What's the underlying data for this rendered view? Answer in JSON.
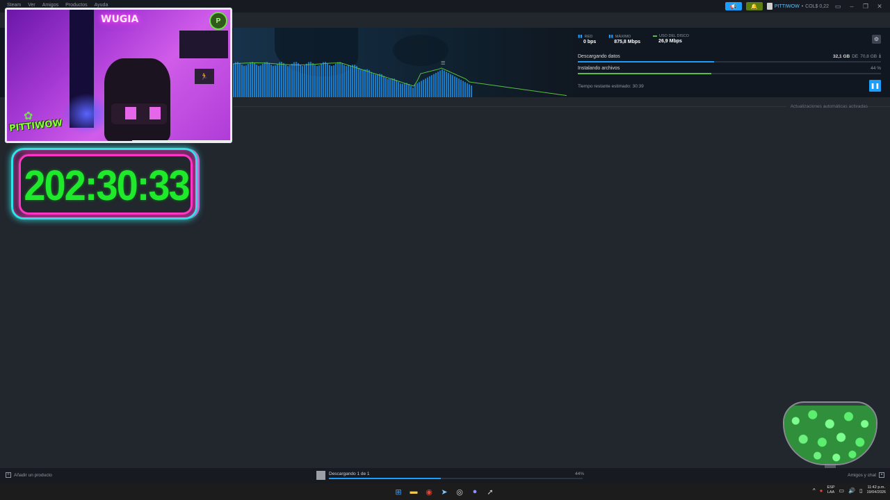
{
  "window": {
    "menu": [
      "Steam",
      "Ver",
      "Amigos",
      "Productos",
      "Ayuda"
    ],
    "account_name": "PITTIWOW",
    "wallet": "COL$ 0,22"
  },
  "stats": {
    "network_label": "RED",
    "network_value": "0 bps",
    "peak_label": "MÁXIMO",
    "peak_value": "875,8 Mbps",
    "disk_label": "USO DEL DISCO",
    "disk_value": "26,9 Mbps"
  },
  "download": {
    "label": "Descargando datos",
    "downloaded": "32,1 GB",
    "of_word": "DE",
    "total": "70,8 GB",
    "progress": 0.45
  },
  "install": {
    "label": "Instalando archivos",
    "percent": "44 %",
    "progress": 0.44
  },
  "eta": "Tiempo restante estimado: 30:39",
  "auto_updates": "Actualizaciones automáticas activadas",
  "overlay": {
    "neon": "WUGIA",
    "logo_text": "PITTIWOW",
    "timer": "202:30:33"
  },
  "footer": {
    "add_product": "Añadir un producto",
    "downloading": "Descargando 1 de 1",
    "percent": "44%",
    "progress": 0.44,
    "friends": "Amigos y chat"
  },
  "taskbar": {
    "lang1": "ESP",
    "lang2": "LAA",
    "time": "11:42 p.m.",
    "date": "19/04/2026"
  },
  "colors": {
    "accent": "#1a9fff",
    "green": "#59bf40",
    "timer_green": "#1eea2b",
    "neon_cyan": "#2ee6e6",
    "neon_pink": "#ff35c5"
  }
}
